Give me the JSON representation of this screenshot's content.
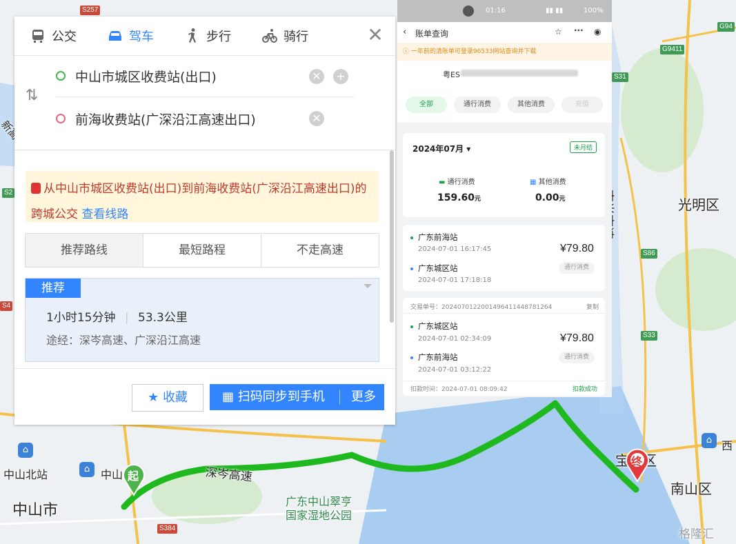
{
  "map": {
    "labels": {
      "guangming": "光明区",
      "nanshan": "南山区",
      "baoan": "宝安区",
      "zhongshan_city": "中山市",
      "zhongshan_north": "中山北站",
      "zhongshan_station": "中山",
      "shencen": "深岑高速",
      "nanguang": "南光高速",
      "wetland": "广东中山翠亨国家湿地公园",
      "west": "西",
      "xin": "新高",
      "watermark": "格隆汇"
    },
    "highways": [
      "S257",
      "G94",
      "G9411",
      "S31",
      "S86",
      "S33",
      "S384",
      "S2",
      "S4"
    ],
    "start_marker": "起",
    "end_marker": "终",
    "route_color": "#1fb81f"
  },
  "panel": {
    "modes": [
      "公交",
      "驾车",
      "步行",
      "骑行"
    ],
    "active_mode": "驾车",
    "start": "中山市城区收费站(出口)",
    "end": "前海收费站(广深沿江高速出口)",
    "notice_text": "从中山市城区收费站(出口)到前海收费站(广深沿江高速出口)的跨城公交",
    "notice_link": "查看线路",
    "route_tabs": [
      "推荐路线",
      "最短路程",
      "不走高速"
    ],
    "recommend_badge": "推荐",
    "duration": "1小时15分钟",
    "distance": "53.3公里",
    "via": "途经：深岑高速、广深沿江高速",
    "fav_label": "收藏",
    "scan_label": "扫码同步到手机",
    "more_label": "更多"
  },
  "phone": {
    "time": "01:16",
    "battery": "100%",
    "title": "账单查询",
    "notice": "一年前的清账单可登录96533网站查询并下载",
    "plate": "粤ES",
    "filters": [
      "全部",
      "通行消费",
      "其他消费",
      "充值"
    ],
    "month": "2024年07月",
    "unsettled": "未月结",
    "toll_label": "通行消费",
    "toll_value": "159.60",
    "other_label": "其他消费",
    "other_value": "0.00",
    "currency": "元",
    "trip1": {
      "from": "广东前海站",
      "from_time": "2024-07-01 16:17:45",
      "to": "广东城区站",
      "to_time": "2024-07-01 17:18:18",
      "amount": "¥79.80",
      "tag": "通行消费"
    },
    "trip2": {
      "tx_label": "交易单号：20240701220014964114487812​64",
      "copy": "复制",
      "from": "广东城区站",
      "from_time": "2024-07-01 02:34:09",
      "to": "广东前海站",
      "to_time": "2024-07-01 03:12:22",
      "amount": "¥79.80",
      "tag": "通行消费",
      "deduct": "扣款时间：2024-07-01 08:09:42",
      "status": "扣款成功"
    }
  }
}
